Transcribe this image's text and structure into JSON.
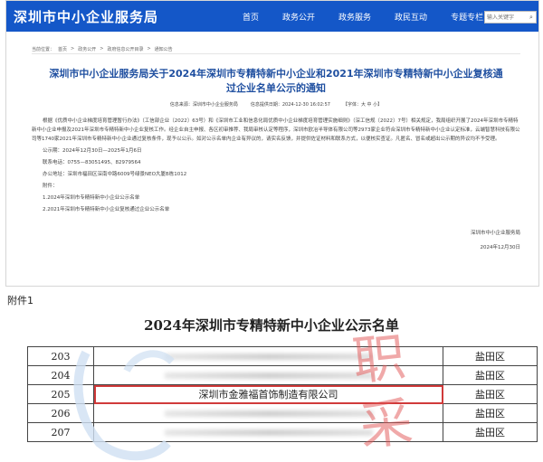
{
  "header": {
    "site_title": "深圳市中小企业服务局",
    "nav": [
      "首页",
      "政务公开",
      "政务服务",
      "政民互动",
      "专题专栏"
    ],
    "search_placeholder": "输入关键字"
  },
  "breadcrumb": [
    "当前位置：",
    "首页",
    "政务公开",
    "政府信息公开目录",
    "通知公告"
  ],
  "notice": {
    "title": "深圳市中小企业服务局关于2024年深圳市专精特新中小企业和2021年深圳市专精特新中小企业复核通过企业名单公示的通知",
    "source_label": "信息来源：深圳市中小企业服务局",
    "date_label": "信息提供日期：2024-12-30 16:02:57",
    "font_label": "【字体：大 中 小】",
    "para1": "根据《优质中小企业梯度培育管理暂行办法》（工信部企业〔2022〕63号）和《深圳市工业和信息化局优质中小企业梯度培育管理实施细则》（深工信规〔2022〕7号）相关规定，我局组织开展了2024年深圳市专精特新中小企业申报及2021年深圳市专精特新中小企业复核工作。经企业自主申报、各区初审推荐、我局审核认定等程序，深圳市欧冶半导体有限公司等2973家企业符合深圳市专精特新中小企业认定标准，云端智慧科技有限公司等1740家2021年深圳市专精特新中小企业通过复核条件，现予以公示。如对公示名单内企业有异议的，请实名反馈，并提供佐证材料和联系方式，以便核实查证。凡匿名、冒名或超出公示期的异议均不予受理。",
    "period": "公示期：2024年12月30日—2025年1月6日",
    "phone": "联系电话：0755—83051495、82979564",
    "address": "办公地址：深圳市福田区深南中路6009号绿景NEO大厦B栋1012",
    "attach_label": "附件：",
    "attach1": "1.2024年深圳市专精特新中小企业公示名单",
    "attach2": "2.2021年深圳市专精特新中小企业复核通过企业公示名单",
    "sign_org": "深圳市中小企业服务局",
    "sign_date": "2024年12月30日"
  },
  "attachment": {
    "label": "附件1",
    "table_title": "2024年深圳市专精特新中小企业公示名单",
    "rows": [
      {
        "num": "203",
        "name": "",
        "district": "盐田区",
        "highlight": false
      },
      {
        "num": "204",
        "name": "",
        "district": "盐田区",
        "highlight": false
      },
      {
        "num": "205",
        "name": "深圳市金雅福首饰制造有限公司",
        "district": "盐田区",
        "highlight": true
      },
      {
        "num": "206",
        "name": "",
        "district": "盐田区",
        "highlight": false
      },
      {
        "num": "207",
        "name": "",
        "district": "盐田区",
        "highlight": false
      }
    ]
  },
  "colors": {
    "brand": "#1457c8",
    "title": "#1f4fa0",
    "highlight": "#d03a3a",
    "watermark": "#e25555"
  }
}
